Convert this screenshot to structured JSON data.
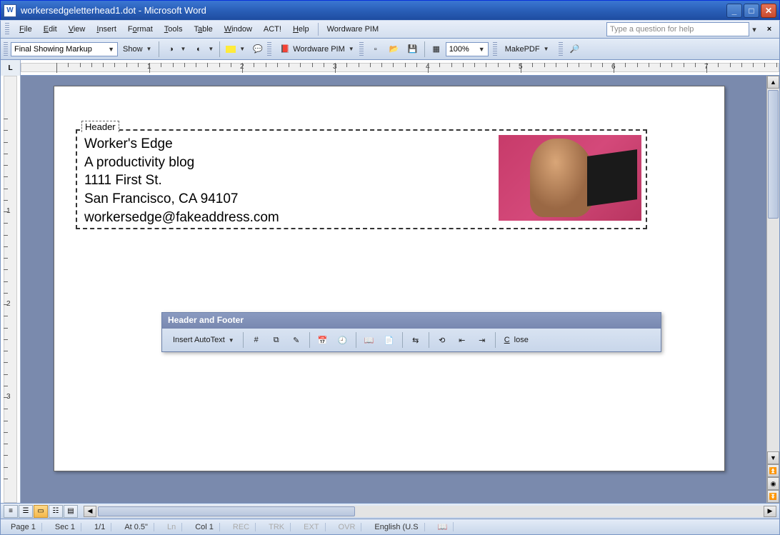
{
  "window": {
    "title": "workersedgeletterhead1.dot - Microsoft Word"
  },
  "menu": {
    "items": [
      "File",
      "Edit",
      "View",
      "Insert",
      "Format",
      "Tools",
      "Table",
      "Window",
      "ACT!",
      "Help"
    ],
    "extra": "Wordware PIM",
    "ask_placeholder": "Type a question for help"
  },
  "toolbar": {
    "markup_combo": "Final Showing Markup",
    "show_label": "Show",
    "wordware_label": "Wordware PIM",
    "zoom": "100%",
    "makepdf_label": "MakePDF"
  },
  "document": {
    "header_label": "Header",
    "lines": [
      "Worker's Edge",
      "A productivity blog",
      "1111 First St.",
      "San Francisco, CA 94107",
      "workersedge@fakeaddress.com"
    ]
  },
  "hf_toolbar": {
    "title": "Header and Footer",
    "autotext": "Insert AutoText",
    "close": "Close"
  },
  "status": {
    "page": "Page  1",
    "sec": "Sec 1",
    "pages": "1/1",
    "at": "At 0.5\"",
    "ln": "Ln",
    "col": "Col  1",
    "rec": "REC",
    "trk": "TRK",
    "ext": "EXT",
    "ovr": "OVR",
    "lang": "English (U.S"
  },
  "ruler_nums": [
    "1",
    "2",
    "3",
    "4",
    "5",
    "6",
    "7"
  ],
  "vruler_nums": [
    "1",
    "2",
    "3"
  ]
}
